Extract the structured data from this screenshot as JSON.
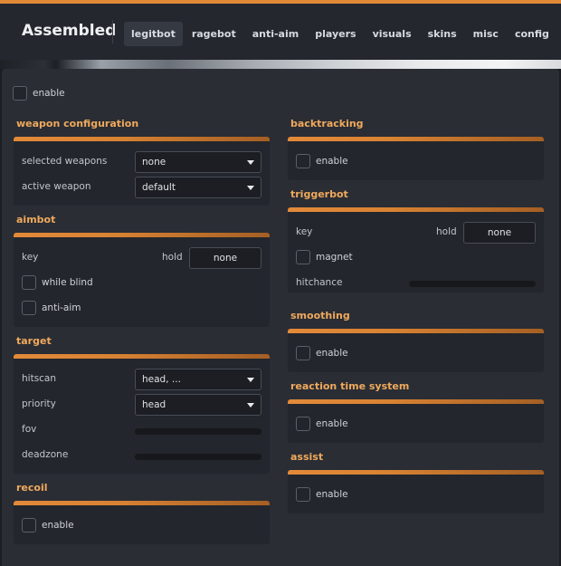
{
  "app": {
    "title": "Assembled"
  },
  "tabs": [
    "legitbot",
    "ragebot",
    "anti-aim",
    "players",
    "visuals",
    "skins",
    "misc",
    "config"
  ],
  "active_tab": "legitbot",
  "master_enable": {
    "label": "enable",
    "checked": false
  },
  "left": {
    "weapon_configuration": {
      "title": "weapon configuration",
      "selected_weapons": {
        "label": "selected weapons",
        "value": "none"
      },
      "active_weapon": {
        "label": "active weapon",
        "value": "default"
      }
    },
    "aimbot": {
      "title": "aimbot",
      "key": {
        "label": "key",
        "mode": "hold",
        "value": "none"
      },
      "while_blind": {
        "label": "while blind",
        "checked": false
      },
      "anti_aim": {
        "label": "anti-aim",
        "checked": false
      }
    },
    "target": {
      "title": "target",
      "hitscan": {
        "label": "hitscan",
        "value": "head, ..."
      },
      "priority": {
        "label": "priority",
        "value": "head"
      },
      "fov": {
        "label": "fov",
        "value": 0
      },
      "deadzone": {
        "label": "deadzone",
        "value": 0
      }
    },
    "recoil": {
      "title": "recoil",
      "enable": {
        "label": "enable",
        "checked": false
      }
    }
  },
  "right": {
    "backtracking": {
      "title": "backtracking",
      "enable": {
        "label": "enable",
        "checked": false
      }
    },
    "triggerbot": {
      "title": "triggerbot",
      "key": {
        "label": "key",
        "mode": "hold",
        "value": "none"
      },
      "magnet": {
        "label": "magnet",
        "checked": false
      },
      "hitchance": {
        "label": "hitchance",
        "value": 0
      }
    },
    "smoothing": {
      "title": "smoothing",
      "enable": {
        "label": "enable",
        "checked": false
      }
    },
    "reaction_time_system": {
      "title": "reaction time system",
      "enable": {
        "label": "enable",
        "checked": false
      }
    },
    "assist": {
      "title": "assist",
      "enable": {
        "label": "enable",
        "checked": false
      }
    }
  },
  "colors": {
    "accent": "#e08a35",
    "section_title": "#f0a95c",
    "panel": "#2a2d34",
    "group": "#23262c"
  }
}
